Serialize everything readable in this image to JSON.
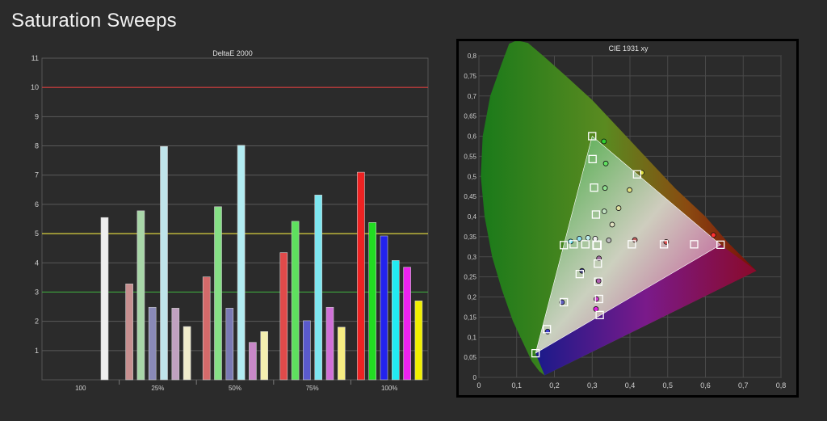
{
  "page": {
    "title": "Saturation Sweeps"
  },
  "chart_data": [
    {
      "type": "bar",
      "title": "DeltaE 2000",
      "categories": [
        "100",
        "25%",
        "50%",
        "75%",
        "100%"
      ],
      "ylim": [
        0,
        11
      ],
      "yticks": [
        1,
        2,
        3,
        4,
        5,
        6,
        7,
        8,
        9,
        10,
        11
      ],
      "grid": true,
      "reference_lines": [
        {
          "value": 10,
          "color": "#d43a3a"
        },
        {
          "value": 5,
          "color": "#d7cf3c"
        },
        {
          "value": 3,
          "color": "#3ea53e"
        }
      ],
      "groups": [
        {
          "category": "100",
          "bars": [
            {
              "value": 5.55,
              "color": "#eeeeee"
            }
          ]
        },
        {
          "category": "25%",
          "bars": [
            {
              "value": 3.28,
              "color": "#c79090"
            },
            {
              "value": 5.78,
              "color": "#a8d6a8"
            },
            {
              "value": 2.48,
              "color": "#8a8ab8"
            },
            {
              "value": 7.98,
              "color": "#bfe4ea"
            },
            {
              "value": 2.45,
              "color": "#bfa1bf"
            },
            {
              "value": 1.82,
              "color": "#f0eccc"
            }
          ]
        },
        {
          "category": "50%",
          "bars": [
            {
              "value": 3.52,
              "color": "#d46a6a"
            },
            {
              "value": 5.92,
              "color": "#86e086"
            },
            {
              "value": 2.45,
              "color": "#7a7ab4"
            },
            {
              "value": 8.02,
              "color": "#b2ecf2"
            },
            {
              "value": 1.28,
              "color": "#c888c8"
            },
            {
              "value": 1.65,
              "color": "#f4efb0"
            }
          ]
        },
        {
          "category": "75%",
          "bars": [
            {
              "value": 4.35,
              "color": "#e04a4a"
            },
            {
              "value": 5.42,
              "color": "#5ee05e"
            },
            {
              "value": 2.02,
              "color": "#5a5acc"
            },
            {
              "value": 6.32,
              "color": "#7ee6f0"
            },
            {
              "value": 2.48,
              "color": "#d070d8"
            },
            {
              "value": 1.8,
              "color": "#f6ec82"
            }
          ]
        },
        {
          "category": "100%",
          "bars": [
            {
              "value": 7.1,
              "color": "#ee2222"
            },
            {
              "value": 5.38,
              "color": "#22dd22"
            },
            {
              "value": 4.92,
              "color": "#2222ee"
            },
            {
              "value": 4.08,
              "color": "#22eaf2"
            },
            {
              "value": 3.85,
              "color": "#ec22ee"
            },
            {
              "value": 2.7,
              "color": "#f0f000"
            }
          ]
        }
      ]
    },
    {
      "type": "scatter",
      "title": "CIE 1931 xy",
      "xlim": [
        0,
        0.8
      ],
      "ylim": [
        0,
        0.8
      ],
      "xticks": [
        0,
        0.1,
        0.2,
        0.3,
        0.4,
        0.5,
        0.6,
        0.7,
        0.8
      ],
      "yticks": [
        0,
        0.05,
        0.1,
        0.15,
        0.2,
        0.25,
        0.3,
        0.35,
        0.4,
        0.45,
        0.5,
        0.55,
        0.6,
        0.65,
        0.7,
        0.75,
        0.8
      ],
      "xtick_labels": [
        "0",
        "0,1",
        "0,2",
        "0,3",
        "0,4",
        "0,5",
        "0,6",
        "0,7",
        "0,8"
      ],
      "ytick_labels": [
        "0",
        "0,05",
        "0,1",
        "0,15",
        "0,2",
        "0,25",
        "0,3",
        "0,35",
        "0,4",
        "0,45",
        "0,5",
        "0,55",
        "0,6",
        "0,65",
        "0,7",
        "0,75",
        "0,8"
      ],
      "grid": true,
      "gamut_triangle": [
        [
          0.64,
          0.33
        ],
        [
          0.3,
          0.6
        ],
        [
          0.15,
          0.06
        ]
      ],
      "white_point": [
        0.3127,
        0.329
      ],
      "targets": [
        [
          0.64,
          0.33
        ],
        [
          0.57,
          0.331
        ],
        [
          0.49,
          0.331
        ],
        [
          0.405,
          0.331
        ],
        [
          0.3,
          0.6
        ],
        [
          0.301,
          0.543
        ],
        [
          0.305,
          0.472
        ],
        [
          0.31,
          0.405
        ],
        [
          0.15,
          0.06
        ],
        [
          0.18,
          0.12
        ],
        [
          0.225,
          0.187
        ],
        [
          0.267,
          0.257
        ],
        [
          0.225,
          0.329
        ],
        [
          0.251,
          0.331
        ],
        [
          0.282,
          0.331
        ],
        [
          0.3127,
          0.329
        ],
        [
          0.419,
          0.505
        ],
        [
          0.32,
          0.155
        ],
        [
          0.318,
          0.195
        ],
        [
          0.316,
          0.238
        ],
        [
          0.315,
          0.283
        ]
      ],
      "measured": [
        {
          "x": 0.621,
          "y": 0.354,
          "color": "#ff3030"
        },
        {
          "x": 0.496,
          "y": 0.337,
          "color": "#e05050"
        },
        {
          "x": 0.413,
          "y": 0.342,
          "color": "#c06060"
        },
        {
          "x": 0.344,
          "y": 0.341,
          "color": "#bbbbbb"
        },
        {
          "x": 0.331,
          "y": 0.587,
          "color": "#30d030"
        },
        {
          "x": 0.336,
          "y": 0.532,
          "color": "#60e060"
        },
        {
          "x": 0.334,
          "y": 0.471,
          "color": "#90e090"
        },
        {
          "x": 0.332,
          "y": 0.413,
          "color": "#c0e0c0"
        },
        {
          "x": 0.182,
          "y": 0.114,
          "color": "#4040d0"
        },
        {
          "x": 0.22,
          "y": 0.187,
          "color": "#6060c0"
        },
        {
          "x": 0.273,
          "y": 0.265,
          "color": "#404080"
        },
        {
          "x": 0.243,
          "y": 0.338,
          "color": "#60e0f0"
        },
        {
          "x": 0.266,
          "y": 0.345,
          "color": "#90e0f0"
        },
        {
          "x": 0.289,
          "y": 0.347,
          "color": "#c0f0f0"
        },
        {
          "x": 0.431,
          "y": 0.509,
          "color": "#e0e040"
        },
        {
          "x": 0.399,
          "y": 0.466,
          "color": "#e0e080"
        },
        {
          "x": 0.37,
          "y": 0.421,
          "color": "#e0e0a0"
        },
        {
          "x": 0.353,
          "y": 0.38,
          "color": "#e0e0c0"
        },
        {
          "x": 0.31,
          "y": 0.17,
          "color": "#e020e0"
        },
        {
          "x": 0.311,
          "y": 0.195,
          "color": "#d040d0"
        },
        {
          "x": 0.317,
          "y": 0.24,
          "color": "#b060b0"
        },
        {
          "x": 0.318,
          "y": 0.296,
          "color": "#a070a0"
        },
        {
          "x": 0.308,
          "y": 0.345,
          "color": "#eeeeee"
        }
      ]
    }
  ]
}
